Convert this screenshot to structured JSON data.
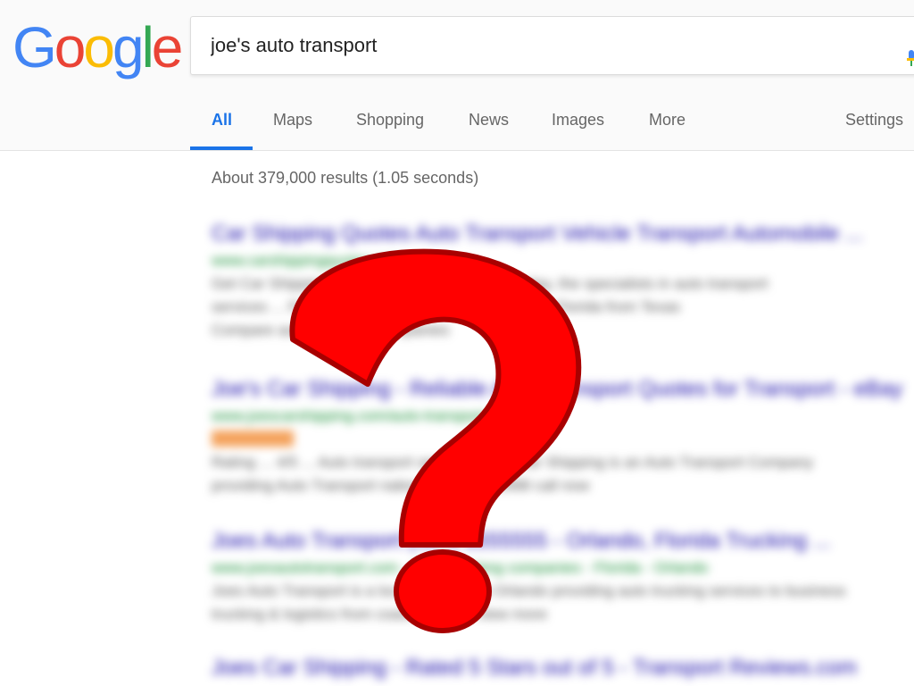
{
  "logo": {
    "text": "Google",
    "letters": [
      {
        "char": "G",
        "color": "#4285F4"
      },
      {
        "char": "o",
        "color": "#EA4335"
      },
      {
        "char": "o",
        "color": "#FBBC05"
      },
      {
        "char": "g",
        "color": "#4285F4"
      },
      {
        "char": "l",
        "color": "#34A853"
      },
      {
        "char": "e",
        "color": "#EA4335"
      }
    ]
  },
  "search": {
    "value": "joe's auto transport",
    "placeholder": ""
  },
  "tabs": {
    "all": "All",
    "maps": "Maps",
    "shopping": "Shopping",
    "news": "News",
    "images": "Images",
    "more": "More",
    "settings": "Settings"
  },
  "stats": "About 379,000 results (1.05 seconds)",
  "results": [
    {
      "title": "Car Shipping Quotes Auto Transport Vehicle Transport Automobile ...",
      "url": "www.carshippingquotes.com",
      "snippet": [
        "Get Car Shipping quotes ... vehicle transport today, the specialists in auto transport",
        "services ... Find the best rates for shipping a car to Florida from Texas",
        "Compare auto transport companies"
      ]
    },
    {
      "title": "Joe's Car Shipping - Reliable Auto Transport Quotes for Transport - eBay",
      "url": "www.joescarshipping.com/auto-transport",
      "badge": true,
      "snippet": [
        "Rating ... 4/5 ... Auto transport services. Joe's car Shipping is an Auto Transport Company",
        "providing Auto Transport nationwide since 1998 call now"
      ]
    },
    {
      "title": "Joes Auto Transport (407) 5555555 - Orlando, Florida Trucking ...",
      "url": "www.joesautotransport.com - 407 - trucking companies - Florida - Orlando",
      "snippet": [
        "Joes Auto Transport is a local business in Orlando providing auto trucking services to business",
        "trucking & logistics from coast to coast, view more"
      ]
    },
    {
      "title": "Joes Car Shipping - Rated 5 Stars out of 5 - Transport Reviews.com",
      "url": "",
      "snippet": []
    }
  ],
  "colors": {
    "accent": "#1a73e8",
    "question_mark_fill": "#ff0000",
    "question_mark_outline": "#a80000"
  },
  "icons": {
    "mic": "microphone-icon",
    "overlay": "question-mark-icon"
  }
}
